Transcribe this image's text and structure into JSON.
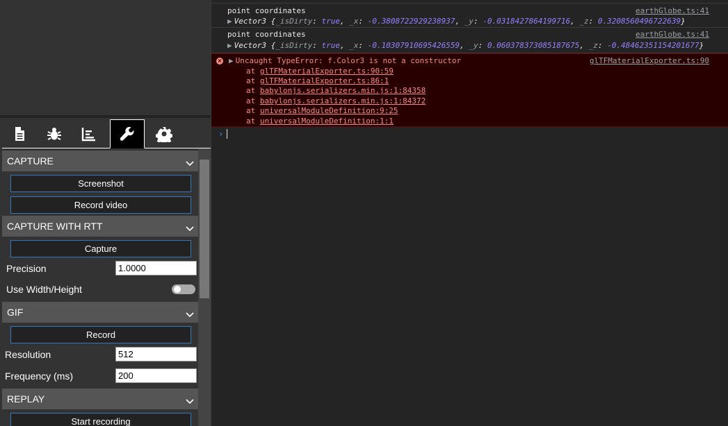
{
  "tabs": [
    {
      "name": "document-icon",
      "active": false
    },
    {
      "name": "bug-icon",
      "active": false
    },
    {
      "name": "chart-icon",
      "active": false
    },
    {
      "name": "wrench-icon",
      "active": true
    },
    {
      "name": "gear-icon",
      "active": false
    }
  ],
  "sections": {
    "capture": {
      "title": "CAPTURE",
      "screenshot": "Screenshot",
      "record_video": "Record video"
    },
    "capture_rtt": {
      "title": "CAPTURE WITH RTT",
      "capture": "Capture",
      "precision_label": "Precision",
      "precision_value": "1.0000",
      "use_wh_label": "Use Width/Height",
      "use_wh_on": false
    },
    "gif": {
      "title": "GIF",
      "record": "Record",
      "resolution_label": "Resolution",
      "resolution_value": "512",
      "frequency_label": "Frequency (ms)",
      "frequency_value": "200"
    },
    "replay": {
      "title": "REPLAY",
      "start_recording": "Start recording"
    }
  },
  "console": {
    "logs": [
      {
        "message": "point coordinates",
        "source": "earthGlobe.ts:41",
        "object_type": "Vector3",
        "is_dirty": "true",
        "x": "-0.3808722929238937",
        "y": "-0.0318427864199716",
        "z": "0.3208560496722639"
      },
      {
        "message": "point coordinates",
        "source": "earthGlobe.ts:41",
        "object_type": "Vector3",
        "is_dirty": "true",
        "x": "-0.10307910695426559",
        "y": "0.060378373085187675",
        "z": "-0.48462351154201677"
      }
    ],
    "error": {
      "message": "Uncaught TypeError: f.Color3 is not a constructor",
      "source": "glTFMaterialExporter.ts:90",
      "frames": [
        "glTFMaterialExporter.ts:90:59",
        "glTFMaterialExporter.ts:86:1",
        "babylonjs.serializers.min.js:1:84358",
        "babylonjs.serializers.min.js:1:84372",
        "universalModuleDefinition:9:25",
        "universalModuleDefinition:1:1"
      ],
      "at_label": "at"
    },
    "prompt_symbol": "›"
  }
}
